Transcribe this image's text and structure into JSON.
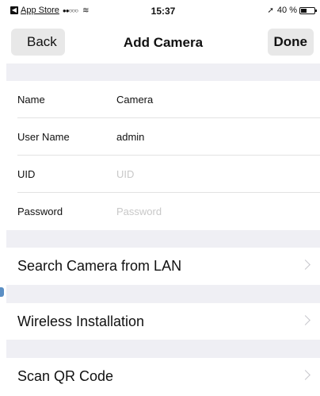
{
  "status_bar": {
    "app_name": "App Store",
    "signal": "●●○○○",
    "wifi": "≋",
    "time": "15:37",
    "location_icon": "➚",
    "battery_text": "40 %",
    "battery_level": 0.4
  },
  "nav": {
    "back_label": "Back",
    "title": "Add Camera",
    "done_label": "Done"
  },
  "form": {
    "name": {
      "label": "Name",
      "value": "Camera",
      "placeholder": ""
    },
    "user_name": {
      "label": "User Name",
      "value": "admin",
      "placeholder": ""
    },
    "uid": {
      "label": "UID",
      "value": "",
      "placeholder": "UID"
    },
    "password": {
      "label": "Password",
      "value": "",
      "placeholder": "Password"
    }
  },
  "actions": [
    {
      "label": "Search Camera from LAN"
    },
    {
      "label": "Wireless Installation"
    },
    {
      "label": "Scan QR Code"
    }
  ],
  "colors": {
    "section_background": "#efeff4",
    "button_background": "#e8e8e8",
    "chevron": "#c7c7cc",
    "placeholder": "#c8c8c8"
  },
  "icons": {
    "app_back": "back-app-icon",
    "signal": "signal-icon",
    "wifi": "wifi-icon",
    "location": "location-icon",
    "battery": "battery-icon",
    "chevron": "chevron-right-icon"
  }
}
